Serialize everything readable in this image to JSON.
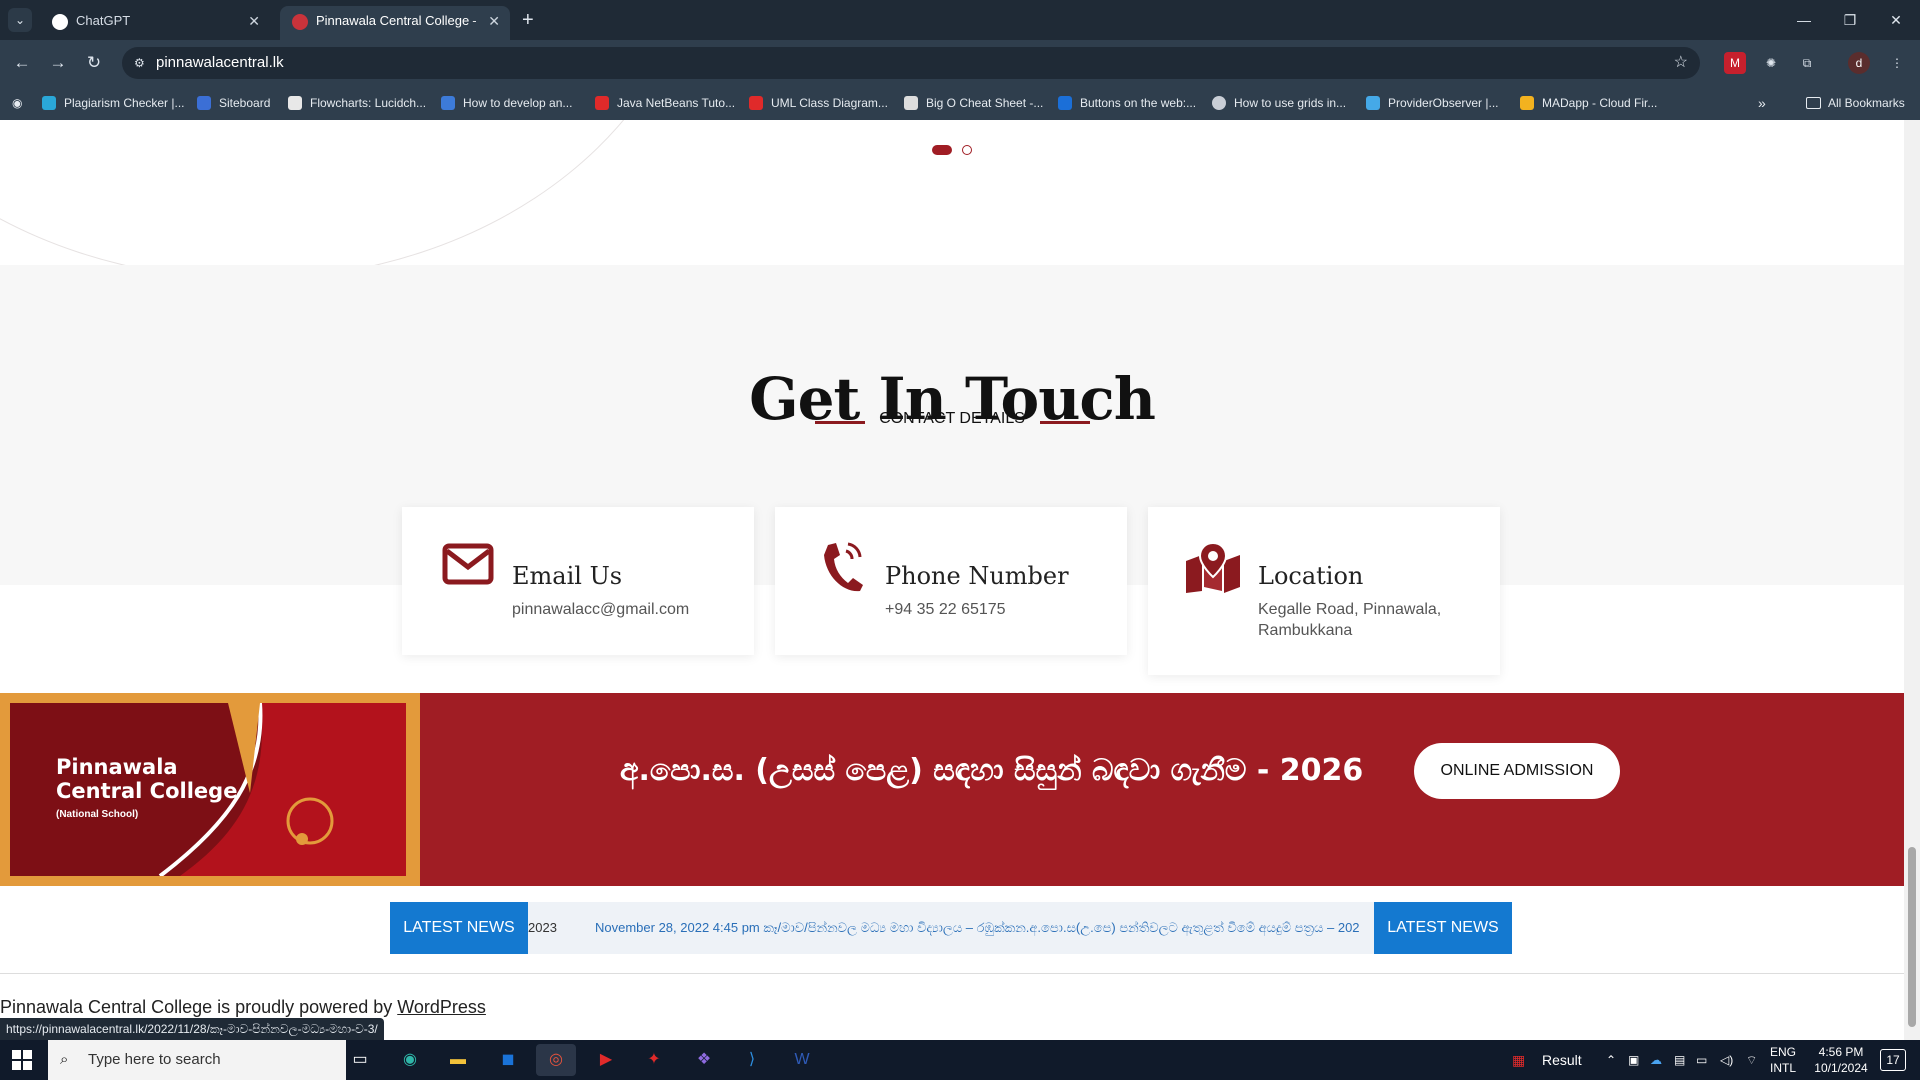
{
  "browser": {
    "tabs": [
      {
        "title": "ChatGPT",
        "active": false
      },
      {
        "title": "Pinnawala Central College – We",
        "active": true
      }
    ],
    "url": "pinnawalacentral.lk",
    "profile_initial": "d",
    "bookmarks": [
      {
        "label": "Plagiarism Checker |...",
        "color": "#2aa7d8"
      },
      {
        "label": "Siteboard",
        "color": "#3b6fd6"
      },
      {
        "label": "Flowcharts: Lucidch...",
        "color": "#e8e8e8"
      },
      {
        "label": "How to develop an...",
        "color": "#3d7bd9"
      },
      {
        "label": "Java NetBeans Tuto...",
        "color": "#e02a2a"
      },
      {
        "label": "UML Class Diagram...",
        "color": "#e02a2a"
      },
      {
        "label": "Big O Cheat Sheet -...",
        "color": "#dddddd"
      },
      {
        "label": "Buttons on the web:...",
        "color": "#1b6fd8"
      },
      {
        "label": "How to use grids in...",
        "color": "#c9ced6"
      },
      {
        "label": "ProviderObserver |...",
        "color": "#45a9e8"
      },
      {
        "label": "MADapp - Cloud Fir...",
        "color": "#f3b21f"
      }
    ],
    "bookmarks_more": "»",
    "all_bookmarks": "All Bookmarks"
  },
  "page": {
    "contact": {
      "title": "Get In Touch",
      "subtitle": "CONTACT DETAILS",
      "cards": [
        {
          "icon": "envelope-icon",
          "title": "Email Us",
          "value": "pinnawalacc@gmail.com"
        },
        {
          "icon": "phone-icon",
          "title": "Phone Number",
          "value": "+94 35 22 65175"
        },
        {
          "icon": "map-pin-icon",
          "title": "Location",
          "value_line1": "Kegalle Road, Pinnawala,",
          "value_line2": "Rambukkana"
        }
      ]
    },
    "admission": {
      "logo_name_line1": "Pinnawala",
      "logo_name_line2": "Central College",
      "logo_small": "(National School)",
      "headline": "අ.පො.ස. (උසස් පෙළ) සඳහා සිසුන් බඳවා ගැනීම - 2026",
      "button": "ONLINE ADMISSION"
    },
    "news": {
      "badge": "LATEST NEWS",
      "lead": "2023",
      "ticker": "November 28, 2022 4:45 pm කෑ/මාව/පින්නවල මධ්‍ය මහා විද්‍යාලය – රඹුක්කන.අ.පො.ස(උ.පෙ) පන්තිවලට ඇතුළත් වීමේ අයදුම් පත්‍රය – 202"
    },
    "footer": {
      "text": "Pinnawala Central College is proudly powered by ",
      "link": "WordPress"
    },
    "status_url": "https://pinnawalacentral.lk/2022/11/28/කෑ-මාව-පින්නවල-මධ්‍ය-මහා-ව-3/"
  },
  "taskbar": {
    "search_placeholder": "Type here to search",
    "tray_label": "Result",
    "lang_line1": "ENG",
    "lang_line2": "INTL",
    "time": "4:56 PM",
    "date": "10/1/2024",
    "notifications": "17"
  },
  "colors": {
    "accent_red": "#a01d24",
    "dark_red": "#8b1a1f",
    "news_blue": "#1479d0",
    "chrome_dark": "#1f2a36"
  }
}
